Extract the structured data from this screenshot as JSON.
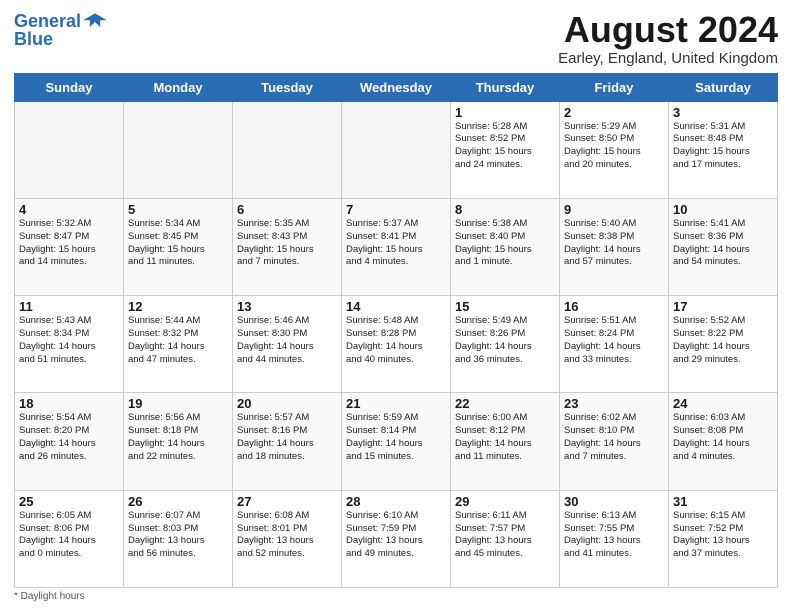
{
  "header": {
    "logo_line1": "General",
    "logo_line2": "Blue",
    "month_title": "August 2024",
    "location": "Earley, England, United Kingdom"
  },
  "days_of_week": [
    "Sunday",
    "Monday",
    "Tuesday",
    "Wednesday",
    "Thursday",
    "Friday",
    "Saturday"
  ],
  "weeks": [
    [
      {
        "day": "",
        "info": ""
      },
      {
        "day": "",
        "info": ""
      },
      {
        "day": "",
        "info": ""
      },
      {
        "day": "",
        "info": ""
      },
      {
        "day": "1",
        "info": "Sunrise: 5:28 AM\nSunset: 8:52 PM\nDaylight: 15 hours\nand 24 minutes."
      },
      {
        "day": "2",
        "info": "Sunrise: 5:29 AM\nSunset: 8:50 PM\nDaylight: 15 hours\nand 20 minutes."
      },
      {
        "day": "3",
        "info": "Sunrise: 5:31 AM\nSunset: 8:48 PM\nDaylight: 15 hours\nand 17 minutes."
      }
    ],
    [
      {
        "day": "4",
        "info": "Sunrise: 5:32 AM\nSunset: 8:47 PM\nDaylight: 15 hours\nand 14 minutes."
      },
      {
        "day": "5",
        "info": "Sunrise: 5:34 AM\nSunset: 8:45 PM\nDaylight: 15 hours\nand 11 minutes."
      },
      {
        "day": "6",
        "info": "Sunrise: 5:35 AM\nSunset: 8:43 PM\nDaylight: 15 hours\nand 7 minutes."
      },
      {
        "day": "7",
        "info": "Sunrise: 5:37 AM\nSunset: 8:41 PM\nDaylight: 15 hours\nand 4 minutes."
      },
      {
        "day": "8",
        "info": "Sunrise: 5:38 AM\nSunset: 8:40 PM\nDaylight: 15 hours\nand 1 minute."
      },
      {
        "day": "9",
        "info": "Sunrise: 5:40 AM\nSunset: 8:38 PM\nDaylight: 14 hours\nand 57 minutes."
      },
      {
        "day": "10",
        "info": "Sunrise: 5:41 AM\nSunset: 8:36 PM\nDaylight: 14 hours\nand 54 minutes."
      }
    ],
    [
      {
        "day": "11",
        "info": "Sunrise: 5:43 AM\nSunset: 8:34 PM\nDaylight: 14 hours\nand 51 minutes."
      },
      {
        "day": "12",
        "info": "Sunrise: 5:44 AM\nSunset: 8:32 PM\nDaylight: 14 hours\nand 47 minutes."
      },
      {
        "day": "13",
        "info": "Sunrise: 5:46 AM\nSunset: 8:30 PM\nDaylight: 14 hours\nand 44 minutes."
      },
      {
        "day": "14",
        "info": "Sunrise: 5:48 AM\nSunset: 8:28 PM\nDaylight: 14 hours\nand 40 minutes."
      },
      {
        "day": "15",
        "info": "Sunrise: 5:49 AM\nSunset: 8:26 PM\nDaylight: 14 hours\nand 36 minutes."
      },
      {
        "day": "16",
        "info": "Sunrise: 5:51 AM\nSunset: 8:24 PM\nDaylight: 14 hours\nand 33 minutes."
      },
      {
        "day": "17",
        "info": "Sunrise: 5:52 AM\nSunset: 8:22 PM\nDaylight: 14 hours\nand 29 minutes."
      }
    ],
    [
      {
        "day": "18",
        "info": "Sunrise: 5:54 AM\nSunset: 8:20 PM\nDaylight: 14 hours\nand 26 minutes."
      },
      {
        "day": "19",
        "info": "Sunrise: 5:56 AM\nSunset: 8:18 PM\nDaylight: 14 hours\nand 22 minutes."
      },
      {
        "day": "20",
        "info": "Sunrise: 5:57 AM\nSunset: 8:16 PM\nDaylight: 14 hours\nand 18 minutes."
      },
      {
        "day": "21",
        "info": "Sunrise: 5:59 AM\nSunset: 8:14 PM\nDaylight: 14 hours\nand 15 minutes."
      },
      {
        "day": "22",
        "info": "Sunrise: 6:00 AM\nSunset: 8:12 PM\nDaylight: 14 hours\nand 11 minutes."
      },
      {
        "day": "23",
        "info": "Sunrise: 6:02 AM\nSunset: 8:10 PM\nDaylight: 14 hours\nand 7 minutes."
      },
      {
        "day": "24",
        "info": "Sunrise: 6:03 AM\nSunset: 8:08 PM\nDaylight: 14 hours\nand 4 minutes."
      }
    ],
    [
      {
        "day": "25",
        "info": "Sunrise: 6:05 AM\nSunset: 8:06 PM\nDaylight: 14 hours\nand 0 minutes."
      },
      {
        "day": "26",
        "info": "Sunrise: 6:07 AM\nSunset: 8:03 PM\nDaylight: 13 hours\nand 56 minutes."
      },
      {
        "day": "27",
        "info": "Sunrise: 6:08 AM\nSunset: 8:01 PM\nDaylight: 13 hours\nand 52 minutes."
      },
      {
        "day": "28",
        "info": "Sunrise: 6:10 AM\nSunset: 7:59 PM\nDaylight: 13 hours\nand 49 minutes."
      },
      {
        "day": "29",
        "info": "Sunrise: 6:11 AM\nSunset: 7:57 PM\nDaylight: 13 hours\nand 45 minutes."
      },
      {
        "day": "30",
        "info": "Sunrise: 6:13 AM\nSunset: 7:55 PM\nDaylight: 13 hours\nand 41 minutes."
      },
      {
        "day": "31",
        "info": "Sunrise: 6:15 AM\nSunset: 7:52 PM\nDaylight: 13 hours\nand 37 minutes."
      }
    ]
  ],
  "footer": {
    "note": "Daylight hours"
  }
}
